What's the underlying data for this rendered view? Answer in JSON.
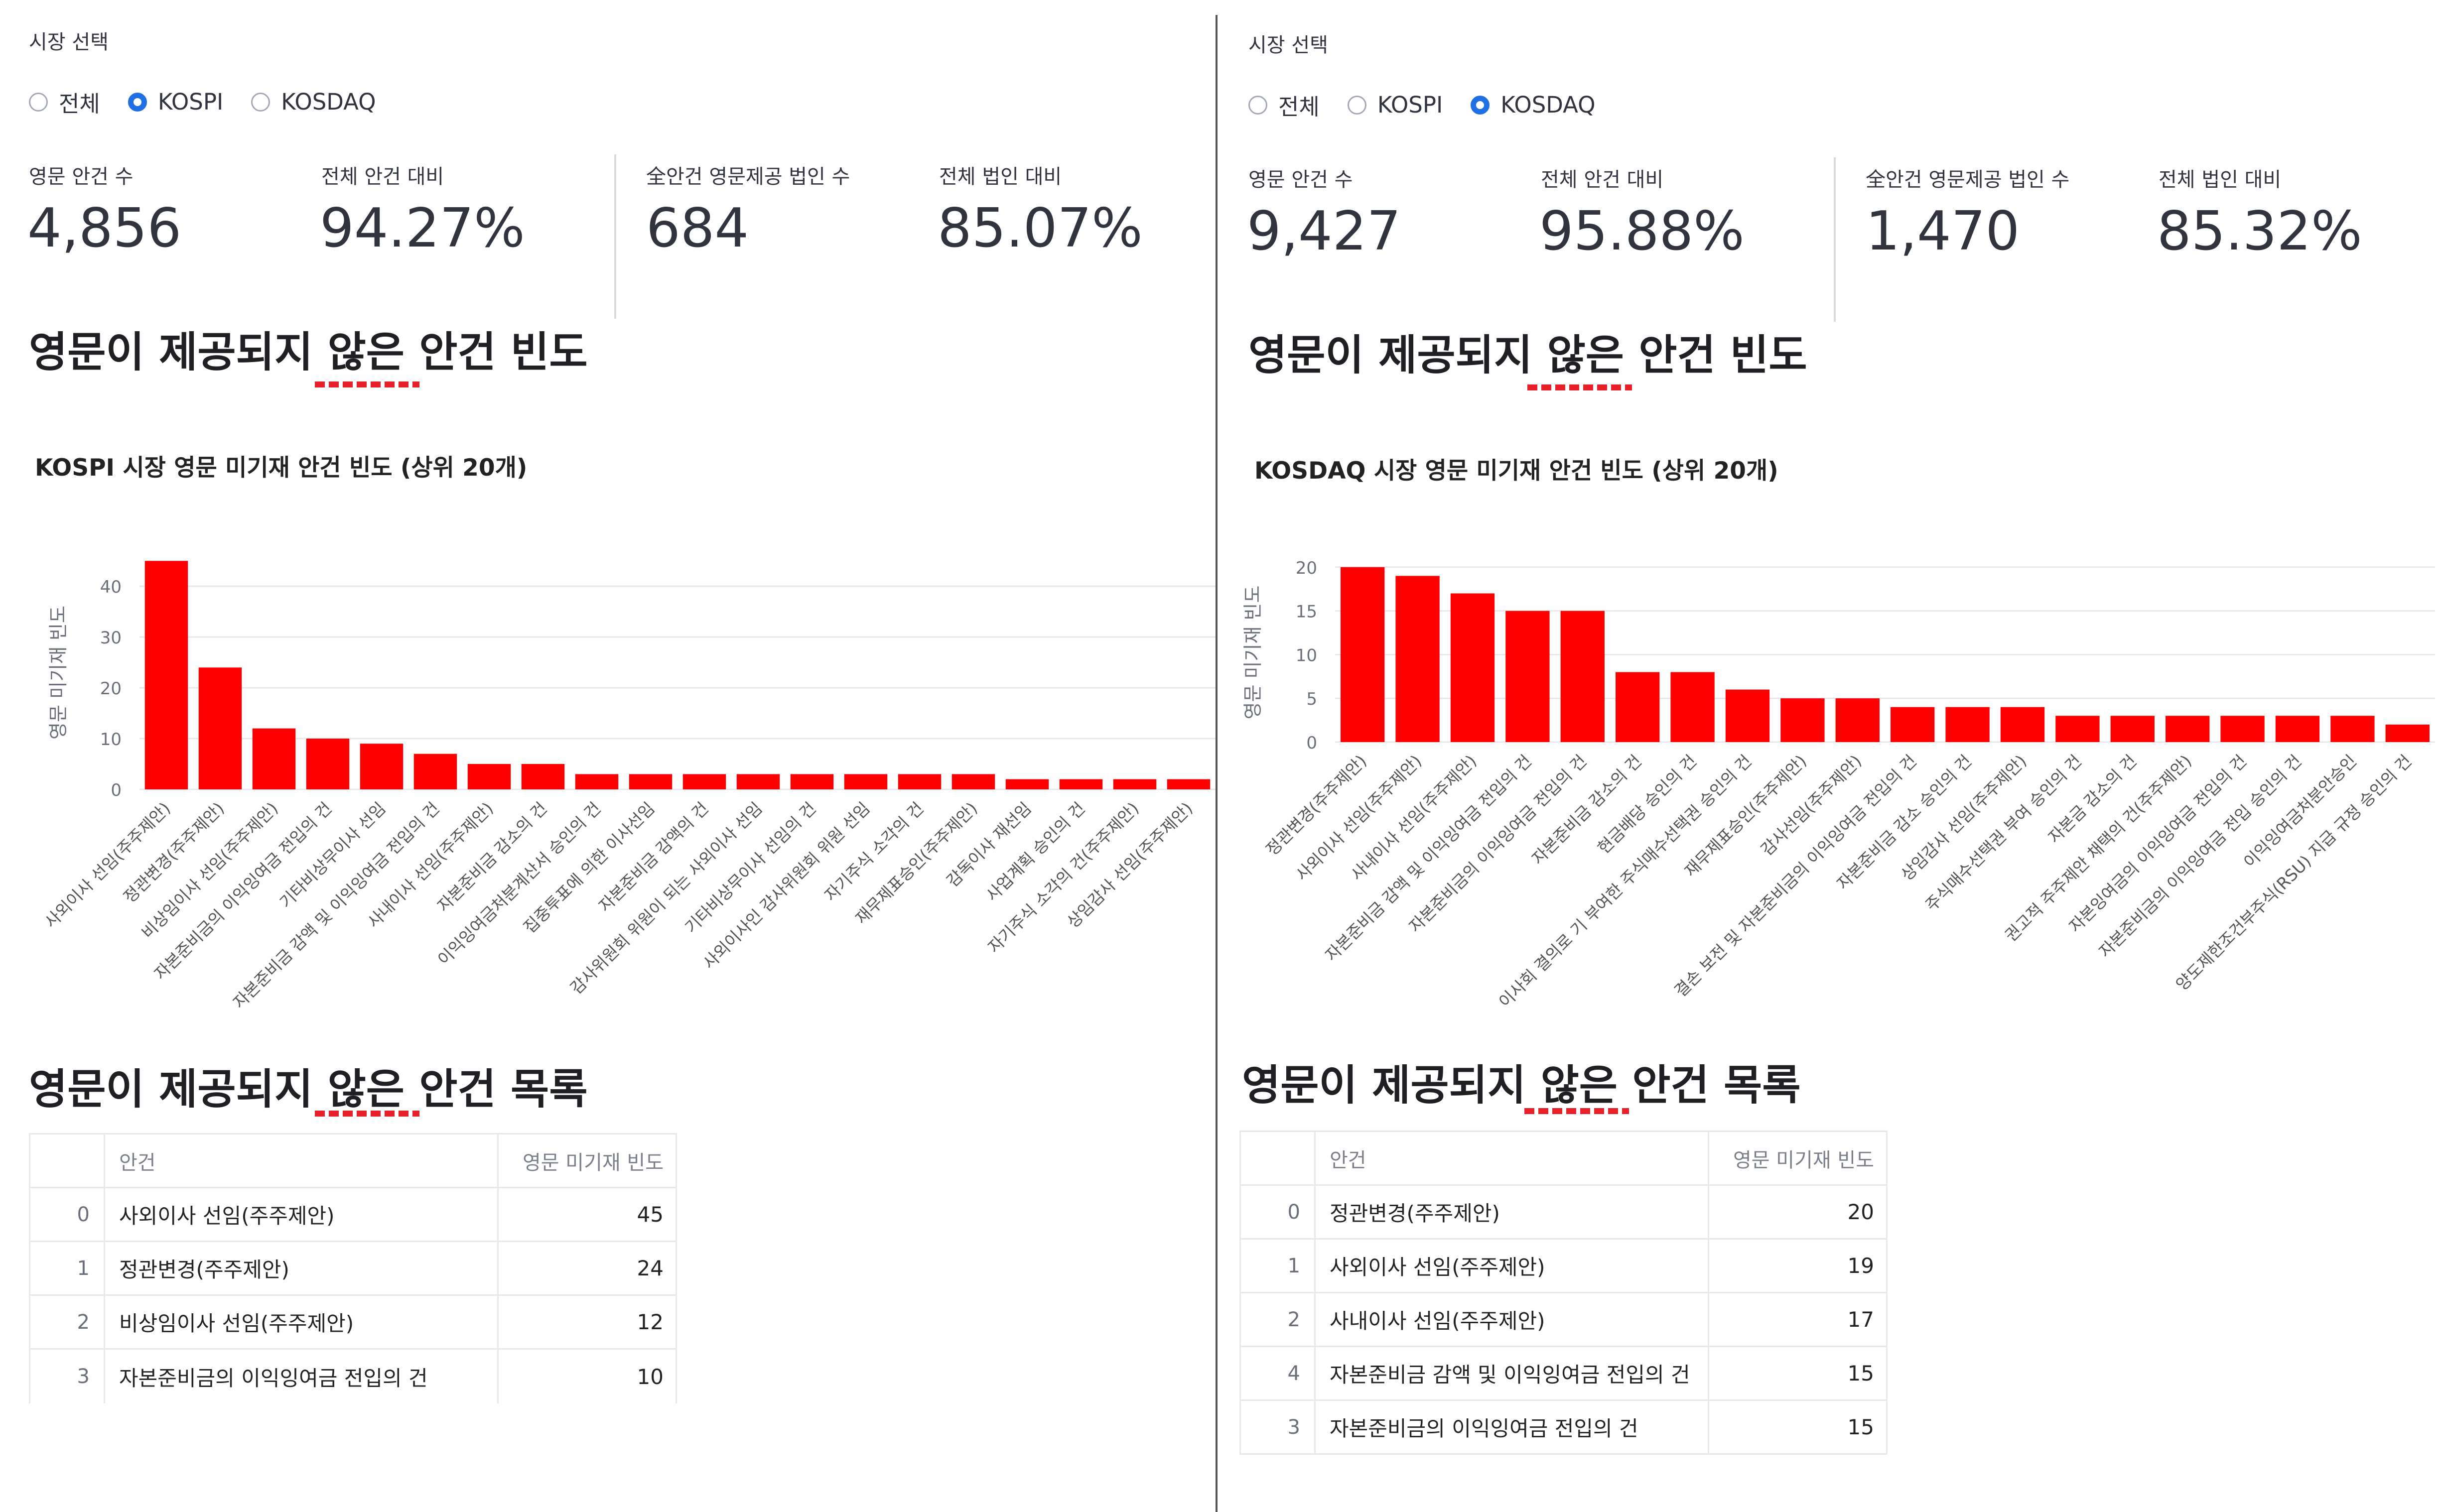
{
  "panels": [
    {
      "market_label": "시장 선택",
      "radio_options": [
        {
          "label": "전체",
          "selected": false
        },
        {
          "label": "KOSPI",
          "selected": true
        },
        {
          "label": "KOSDAQ",
          "selected": false
        }
      ],
      "metrics": [
        {
          "label": "영문 안건 수",
          "value": "4,856"
        },
        {
          "label": "전체 안건 대비",
          "value": "94.27%"
        },
        {
          "label": "全안건 영문제공 법인 수",
          "value": "684"
        },
        {
          "label": "전체 법인 대비",
          "value": "85.07%"
        }
      ],
      "freq_heading": "영문이 제공되지 않은 안건 빈도",
      "list_heading": "영문이 제공되지 않은 안건 목록",
      "table_headers": {
        "item": "안건",
        "freq": "영문 미기재 빈도"
      },
      "table_rows": [
        {
          "index": "0",
          "item": "사외이사 선임(주주제안)",
          "freq": "45"
        },
        {
          "index": "1",
          "item": "정관변경(주주제안)",
          "freq": "24"
        },
        {
          "index": "2",
          "item": "비상임이사 선임(주주제안)",
          "freq": "12"
        },
        {
          "index": "3",
          "item": "자본준비금의 이익잉여금 전입의 건",
          "freq": "10"
        }
      ]
    },
    {
      "market_label": "시장 선택",
      "radio_options": [
        {
          "label": "전체",
          "selected": false
        },
        {
          "label": "KOSPI",
          "selected": false
        },
        {
          "label": "KOSDAQ",
          "selected": true
        }
      ],
      "metrics": [
        {
          "label": "영문 안건 수",
          "value": "9,427"
        },
        {
          "label": "전체 안건 대비",
          "value": "95.88%"
        },
        {
          "label": "全안건 영문제공 법인 수",
          "value": "1,470"
        },
        {
          "label": "전체 법인 대비",
          "value": "85.32%"
        }
      ],
      "freq_heading": "영문이 제공되지 않은 안건 빈도",
      "list_heading": "영문이 제공되지 않은 안건 목록",
      "table_headers": {
        "item": "안건",
        "freq": "영문 미기재 빈도"
      },
      "table_rows": [
        {
          "index": "0",
          "item": "정관변경(주주제안)",
          "freq": "20"
        },
        {
          "index": "1",
          "item": "사외이사 선임(주주제안)",
          "freq": "19"
        },
        {
          "index": "2",
          "item": "사내이사 선임(주주제안)",
          "freq": "17"
        },
        {
          "index": "4",
          "item": "자본준비금 감액 및 이익잉여금 전입의 건",
          "freq": "15"
        },
        {
          "index": "3",
          "item": "자본준비금의 이익잉여금 전입의 건",
          "freq": "15"
        }
      ]
    }
  ],
  "chart_data": [
    {
      "type": "bar",
      "title": "KOSPI 시장 영문 미기재 안건 빈도 (상위 20개)",
      "xlabel": "",
      "ylabel": "영문 미기재 빈도",
      "ylim": [
        0,
        46
      ],
      "yticks": [
        0,
        10,
        20,
        30,
        40
      ],
      "grid": true,
      "bar_color": "#ff0000",
      "categories": [
        "사외이사 선임(주주제안)",
        "정관변경(주주제안)",
        "비상임이사 선임(주주제안)",
        "자본준비금의 이익잉여금 전입의 건",
        "기타비상무이사 선임",
        "자본준비금 감액 및 이익잉여금 전입의 건",
        "사내이사 선임(주주제안)",
        "자본준비금 감소의 건",
        "이익잉여금처분계산서 승인의 건",
        "집중투표에 의한 이사선임",
        "자본준비금 감액의 건",
        "감사위원회 위원이 되는 사외이사 선임",
        "기타비상무이사 선임의 건",
        "사외이사인 감사위원회 위원 선임",
        "자기주식 소각의 건",
        "재무제표승인(주주제안)",
        "감독이사 재선임",
        "사업계획 승인의 건",
        "자기주식 소각의 건(주주제안)",
        "상임감사 선임(주주제안)"
      ],
      "values": [
        45,
        24,
        12,
        10,
        9,
        7,
        5,
        5,
        3,
        3,
        3,
        3,
        3,
        3,
        3,
        3,
        2,
        2,
        2,
        2
      ]
    },
    {
      "type": "bar",
      "title": "KOSDAQ 시장 영문 미기재 안건 빈도 (상위 20개)",
      "xlabel": "",
      "ylabel": "영문 미기재 빈도",
      "ylim": [
        0,
        20.5
      ],
      "yticks": [
        0,
        5,
        10,
        15,
        20
      ],
      "grid": true,
      "bar_color": "#ff0000",
      "categories": [
        "정관변경(주주제안)",
        "사외이사 선임(주주제안)",
        "사내이사 선임(주주제안)",
        "자본준비금 감액 및 이익잉여금 전입의 건",
        "자본준비금의 이익잉여금 전입의 건",
        "자본준비금 감소의 건",
        "현금배당 승인의 건",
        "이사회 결의로 기 부여한 주식매수선택권 승인의 건",
        "재무제표승인(주주제안)",
        "감사선임(주주제안)",
        "결손 보전 및 자본준비금의 이익잉여금 전입의 건",
        "자본준비금 감소 승인의 건",
        "상임감사 선임(주주제안)",
        "주식매수선택권 부여 승인의 건",
        "자본금 감소의 건",
        "권고적 주주제안 채택의 건(주주제안)",
        "자본잉여금의 이익잉여금 전입의 건",
        "자본준비금의 이익잉여금 전입 승인의 건",
        "이익잉여금처분안승인",
        "양도제한조건부주식(RSU) 지급 규정 승인의 건"
      ],
      "values": [
        20,
        19,
        17,
        15,
        15,
        8,
        8,
        6,
        5,
        5,
        4,
        4,
        4,
        3,
        3,
        3,
        3,
        3,
        3,
        2
      ]
    }
  ]
}
